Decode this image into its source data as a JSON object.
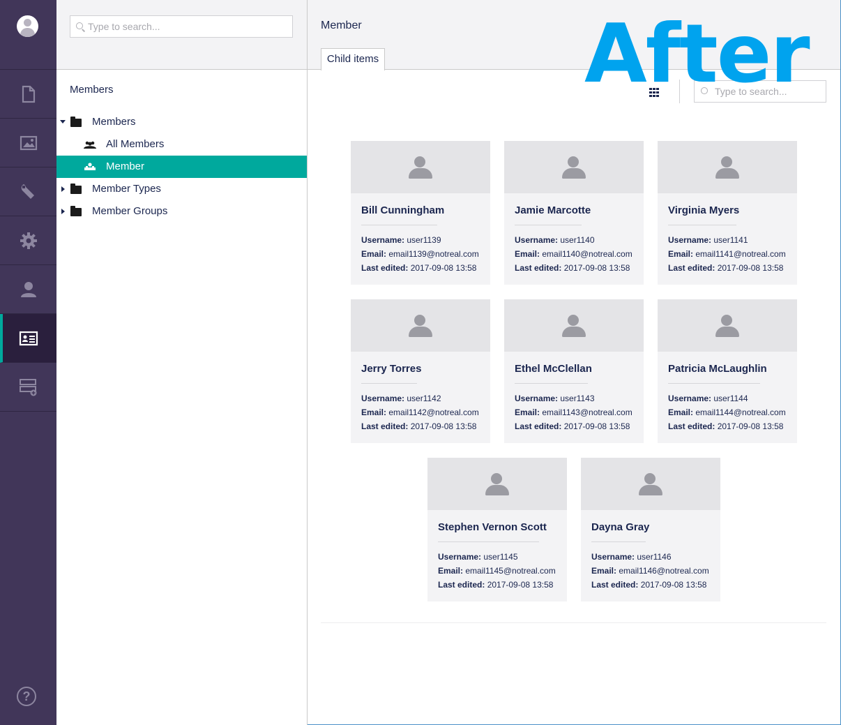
{
  "tree": {
    "search_placeholder": "Type to search...",
    "title": "Members",
    "nodes": [
      {
        "label": "Members",
        "expanded": true
      },
      {
        "label": "All Members"
      },
      {
        "label": "Member",
        "selected": true
      },
      {
        "label": "Member Types"
      },
      {
        "label": "Member Groups"
      }
    ]
  },
  "sections": {
    "icons": [
      "document-icon",
      "image-icon",
      "wrench-icon",
      "gear-icon",
      "user-icon",
      "member-card-icon",
      "forms-icon"
    ],
    "help_glyph": "?"
  },
  "main": {
    "title": "Member",
    "tab_label": "Child items",
    "overlay_text": "After",
    "search_placeholder": "Type to search...",
    "meta_labels": {
      "username": "Username:",
      "email": "Email:",
      "last_edited": "Last edited:"
    },
    "cards": [
      {
        "name": "Bill Cunningham",
        "username": "user1139",
        "email": "email1139@notreal.com",
        "last_edited": "2017-09-08 13:58"
      },
      {
        "name": "Jamie Marcotte",
        "username": "user1140",
        "email": "email1140@notreal.com",
        "last_edited": "2017-09-08 13:58"
      },
      {
        "name": "Virginia Myers",
        "username": "user1141",
        "email": "email1141@notreal.com",
        "last_edited": "2017-09-08 13:58"
      },
      {
        "name": "Jerry Torres",
        "username": "user1142",
        "email": "email1142@notreal.com",
        "last_edited": "2017-09-08 13:58"
      },
      {
        "name": "Ethel McClellan",
        "username": "user1143",
        "email": "email1143@notreal.com",
        "last_edited": "2017-09-08 13:58"
      },
      {
        "name": "Patricia McLaughlin",
        "username": "user1144",
        "email": "email1144@notreal.com",
        "last_edited": "2017-09-08 13:58"
      },
      {
        "name": "Stephen Vernon Scott",
        "username": "user1145",
        "email": "email1145@notreal.com",
        "last_edited": "2017-09-08 13:58"
      },
      {
        "name": "Dayna Gray",
        "username": "user1146",
        "email": "email1146@notreal.com",
        "last_edited": "2017-09-08 13:58"
      }
    ]
  },
  "colors": {
    "sidebar_bg": "#413659",
    "accent": "#00a99d",
    "overlay_text": "#00a3ee",
    "text": "#1b264f"
  }
}
